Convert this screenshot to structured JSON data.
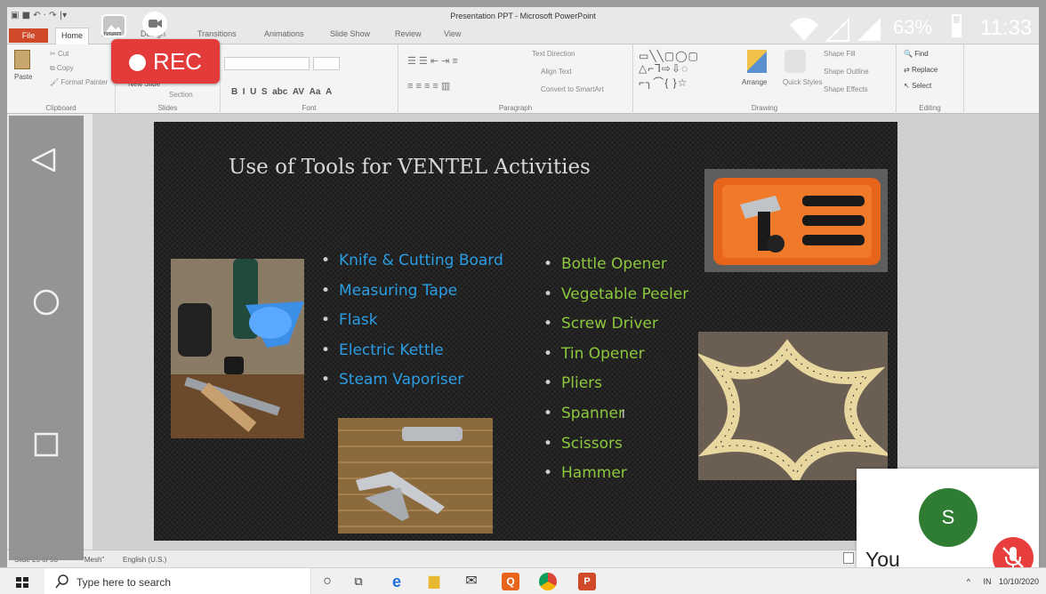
{
  "window": {
    "title": "Presentation PPT - Microsoft PowerPoint",
    "tabs": [
      "File",
      "Home",
      "Insert",
      "Design",
      "Transitions",
      "Animations",
      "Slide Show",
      "Review",
      "View"
    ]
  },
  "ribbon": {
    "clipboard": {
      "paste": "Paste",
      "cut": "Cut",
      "copy": "Copy",
      "format_painter": "Format Painter",
      "label": "Clipboard"
    },
    "slides": {
      "new_slide": "New Slide",
      "section": "Section",
      "label": "Slides"
    },
    "font": {
      "label": "Font"
    },
    "paragraph": {
      "text_direction": "Text Direction",
      "align_text": "Align Text",
      "convert": "Convert to SmartArt",
      "label": "Paragraph"
    },
    "drawing": {
      "arrange": "Arrange",
      "quick_styles": "Quick Styles",
      "shape_fill": "Shape Fill",
      "shape_outline": "Shape Outline",
      "shape_effects": "Shape Effects",
      "label": "Drawing"
    },
    "editing": {
      "find": "Find",
      "replace": "Replace",
      "select": "Select",
      "label": "Editing"
    }
  },
  "slide": {
    "title": "Use of Tools for VENTEL Activities",
    "left_list": [
      "Knife & Cutting Board",
      "Measuring Tape",
      "Flask",
      "Electric Kettle",
      "Steam Vaporiser"
    ],
    "right_list": [
      "Bottle Opener",
      "Vegetable Peeler",
      "Screw Driver",
      "Tin Opener",
      "Pliers",
      "Spanner",
      "Scissors",
      "Hammer"
    ]
  },
  "status": {
    "slide_num": "Slide 25 of 58",
    "theme": "\"Mesh\"",
    "language": "English (U.S.)"
  },
  "overlay": {
    "rec_label": "REC",
    "battery": "63%",
    "time": "11:33",
    "self_initial": "S",
    "self_label": "You"
  },
  "taskbar": {
    "search_placeholder": "Type here to search",
    "tray_lang": "IN",
    "tray_date": "10/10/2020"
  },
  "colors": {
    "rec": "#e33a3a",
    "blue_text": "#2a9ee4",
    "green_text": "#8cc83c",
    "avatar": "#2f7d32"
  }
}
